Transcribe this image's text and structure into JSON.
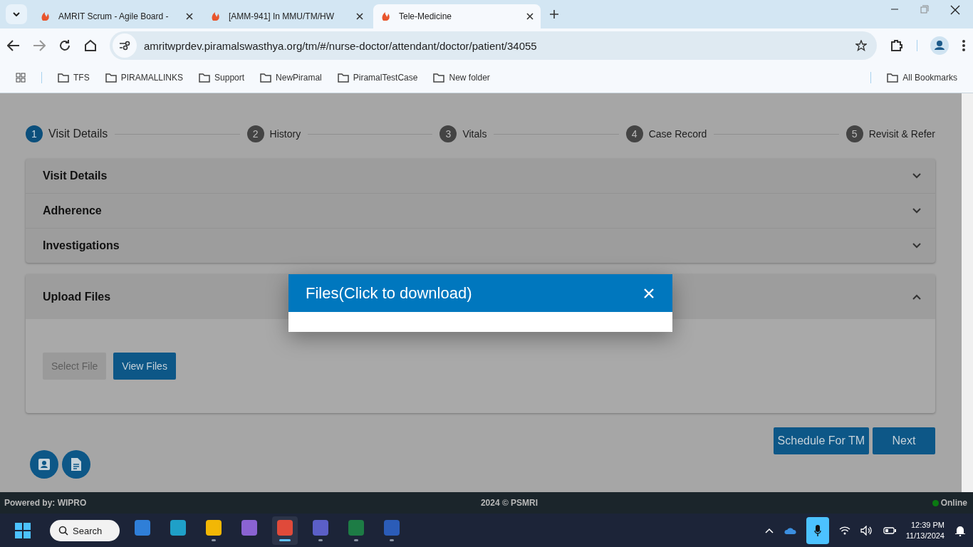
{
  "browser": {
    "tabs": [
      {
        "title": "AMRIT Scrum - Agile Board -",
        "selected": false
      },
      {
        "title": "[AMM-941] In MMU/TM/HW",
        "selected": false
      },
      {
        "title": "Tele-Medicine",
        "selected": true
      }
    ],
    "url": "amritwprdev.piramalswasthya.org/tm/#/nurse-doctor/attendant/doctor/patient/34055",
    "bookmarks": [
      "TFS",
      "PIRAMALLINKS",
      "Support",
      "NewPiramal",
      "PiramalTestCase",
      "New folder"
    ],
    "all_bookmarks": "All Bookmarks"
  },
  "stepper": {
    "steps": [
      {
        "number": "1",
        "label": "Visit Details",
        "selected": true
      },
      {
        "number": "2",
        "label": "History",
        "selected": false
      },
      {
        "number": "3",
        "label": "Vitals",
        "selected": false
      },
      {
        "number": "4",
        "label": "Case Record",
        "selected": false
      },
      {
        "number": "5",
        "label": "Revisit & Refer",
        "selected": false
      }
    ]
  },
  "accordion": [
    {
      "title": "Visit Details",
      "expanded": false
    },
    {
      "title": "Adherence",
      "expanded": false
    },
    {
      "title": "Investigations",
      "expanded": false
    }
  ],
  "upload": {
    "title": "Upload Files",
    "expanded": true,
    "buttons": [
      {
        "label": "Select File",
        "disabled": true
      },
      {
        "label": "View Files",
        "disabled": false
      }
    ]
  },
  "actions": [
    "Schedule For TM",
    "Next"
  ],
  "footer": {
    "left": "Powered by: WIPRO",
    "center": "2024 © PSMRI",
    "status": "Online",
    "online": true
  },
  "dialog": {
    "title": "Files(Click to download)"
  },
  "taskbar": {
    "search": "Search",
    "apps": [
      {
        "running": false,
        "selected": false
      },
      {
        "running": false,
        "selected": false
      },
      {
        "running": true,
        "selected": false
      },
      {
        "running": false,
        "selected": false
      },
      {
        "running": true,
        "selected": true
      },
      {
        "running": true,
        "selected": false
      },
      {
        "running": true,
        "selected": false
      },
      {
        "running": true,
        "selected": false
      }
    ],
    "time": "12:39 PM",
    "date": "11/13/2024"
  }
}
